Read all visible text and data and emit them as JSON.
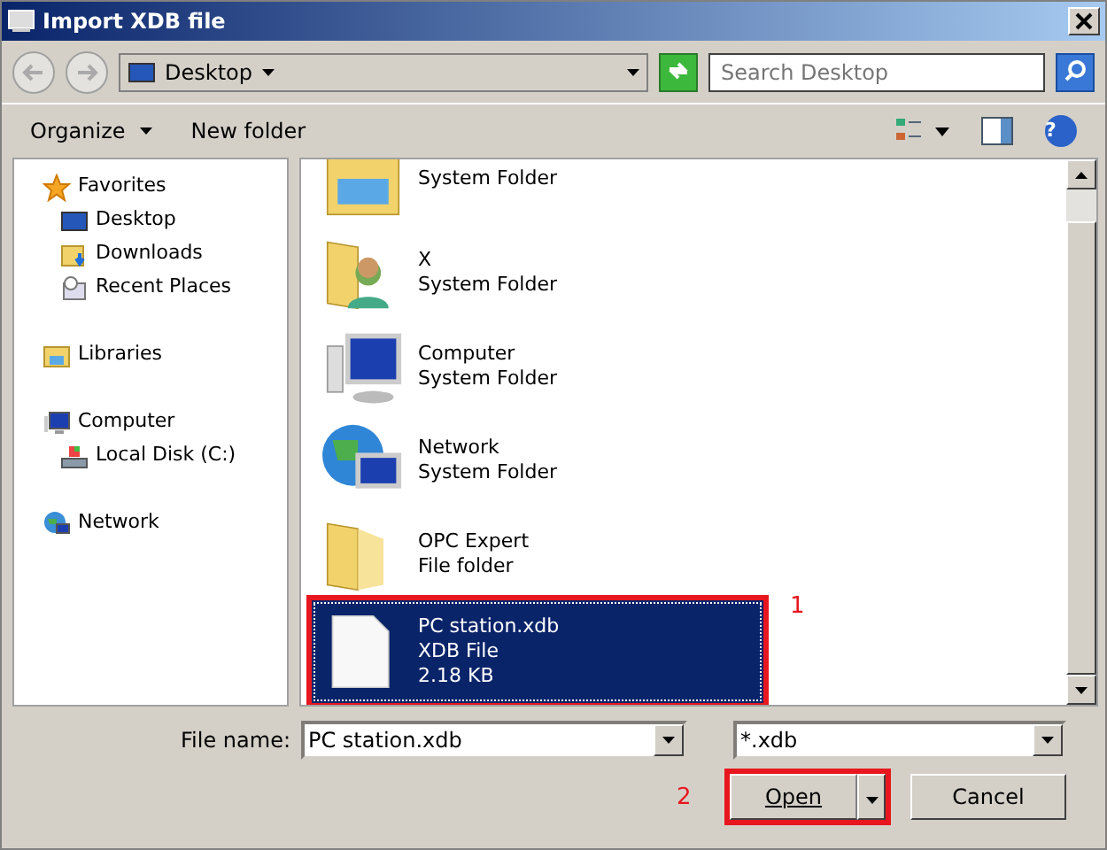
{
  "window": {
    "title": "Import XDB file"
  },
  "address": {
    "location": "Desktop"
  },
  "search": {
    "placeholder": "Search Desktop"
  },
  "toolbar": {
    "organize": "Organize",
    "new_folder": "New folder",
    "help": "?"
  },
  "sidebar": {
    "groups": [
      {
        "label": "Favorites",
        "kind": "star",
        "children": [
          {
            "label": "Desktop",
            "kind": "desktop"
          },
          {
            "label": "Downloads",
            "kind": "downloads"
          },
          {
            "label": "Recent Places",
            "kind": "recent"
          }
        ]
      },
      {
        "label": "Libraries",
        "kind": "library"
      },
      {
        "label": "Computer",
        "kind": "computer",
        "children": [
          {
            "label": "Local Disk (C:)",
            "kind": "disk"
          }
        ]
      },
      {
        "label": "Network",
        "kind": "network"
      }
    ]
  },
  "files": [
    {
      "kind": "library",
      "lines": [
        "System Folder"
      ],
      "selected": false
    },
    {
      "kind": "user-folder",
      "lines": [
        "X",
        "System Folder"
      ],
      "selected": false
    },
    {
      "kind": "computer",
      "lines": [
        "Computer",
        "System Folder"
      ],
      "selected": false
    },
    {
      "kind": "network",
      "lines": [
        "Network",
        "System Folder"
      ],
      "selected": false
    },
    {
      "kind": "folder",
      "lines": [
        "OPC Expert",
        "File folder"
      ],
      "selected": false
    },
    {
      "kind": "file",
      "lines": [
        "PC station.xdb",
        "XDB File",
        "2.18 KB"
      ],
      "selected": true,
      "callout": "1"
    }
  ],
  "file_name": {
    "label": "File name:",
    "value": "PC station.xdb"
  },
  "filter": {
    "value": "*.xdb"
  },
  "buttons": {
    "open": "Open",
    "open_callout": "2",
    "cancel": "Cancel"
  }
}
